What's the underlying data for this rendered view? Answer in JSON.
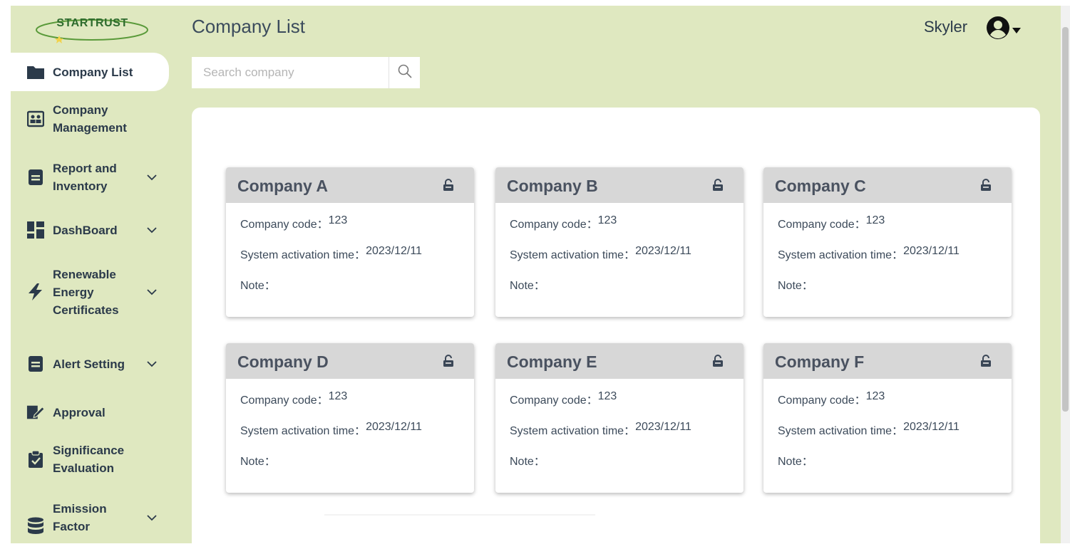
{
  "app": {
    "logo_text": "STARTRUST"
  },
  "header": {
    "title": "Company List",
    "username": "Skyler"
  },
  "search": {
    "placeholder": "Search company"
  },
  "sidebar": {
    "items": [
      {
        "label": "Company List",
        "icon": "folder-icon",
        "active": true,
        "expandable": false
      },
      {
        "label": "Company Management",
        "icon": "id-card-icon",
        "active": false,
        "expandable": false
      },
      {
        "label": "Report and Inventory",
        "icon": "report-icon",
        "active": false,
        "expandable": true
      },
      {
        "label": "DashBoard",
        "icon": "dashboard-icon",
        "active": false,
        "expandable": true
      },
      {
        "label": "Renewable Energy Certificates",
        "icon": "bolt-icon",
        "active": false,
        "expandable": true
      },
      {
        "label": "Alert Setting",
        "icon": "alert-setting-icon",
        "active": false,
        "expandable": true
      },
      {
        "label": "Approval",
        "icon": "signature-icon",
        "active": false,
        "expandable": false
      },
      {
        "label": "Significance Evaluation",
        "icon": "clipboard-check-icon",
        "active": false,
        "expandable": false
      },
      {
        "label": "Emission Factor",
        "icon": "database-icon",
        "active": false,
        "expandable": true
      }
    ]
  },
  "card_labels": {
    "code_label": "Company code：",
    "activation_label": "System activation time：",
    "note_label": "Note："
  },
  "companies": [
    {
      "name": "Company A",
      "code": "123",
      "activation_time": "2023/12/11",
      "note": ""
    },
    {
      "name": "Company B",
      "code": "123",
      "activation_time": "2023/12/11",
      "note": ""
    },
    {
      "name": "Company C",
      "code": "123",
      "activation_time": "2023/12/11",
      "note": ""
    },
    {
      "name": "Company D",
      "code": "123",
      "activation_time": "2023/12/11",
      "note": ""
    },
    {
      "name": "Company E",
      "code": "123",
      "activation_time": "2023/12/11",
      "note": ""
    },
    {
      "name": "Company F",
      "code": "123",
      "activation_time": "2023/12/11",
      "note": ""
    }
  ],
  "colors": {
    "background": "#dfe8c0",
    "text": "#2b3a4a",
    "card_header": "#d7d7d7",
    "logo_green": "#2e6b2e"
  }
}
